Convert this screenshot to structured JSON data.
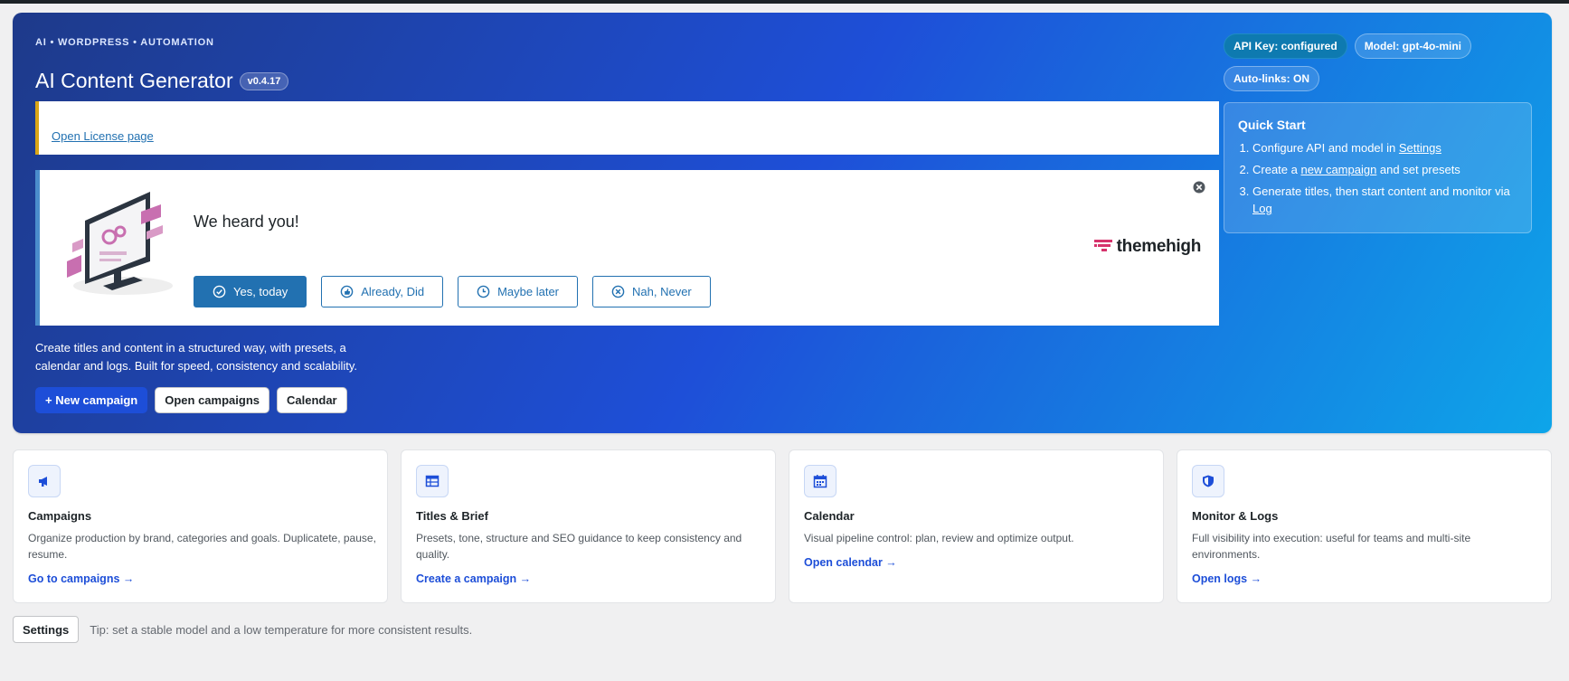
{
  "header": {
    "eyebrow": "AI • WORDPRESS • AUTOMATION",
    "title": "AI Content Generator",
    "version": "v0.4.17"
  },
  "license_notice": {
    "link_label": "Open License page"
  },
  "review_notice": {
    "title": "We heard you!",
    "brand": "themehigh",
    "brand_color": "#d6336c",
    "buttons": [
      {
        "label": "Yes, today",
        "icon": "check-circle-icon"
      },
      {
        "label": "Already, Did",
        "icon": "thumbs-up-icon"
      },
      {
        "label": "Maybe later",
        "icon": "clock-icon"
      },
      {
        "label": "Nah, Never",
        "icon": "x-circle-icon"
      }
    ]
  },
  "hero": {
    "description": "Create titles and content in a structured way, with presets, a calendar and logs. Built for speed, consistency and scalability.",
    "buttons": {
      "new_campaign": "+ New campaign",
      "open_campaigns": "Open campaigns",
      "calendar": "Calendar"
    }
  },
  "badges": {
    "api_key": "API Key: configured",
    "model": "Model: gpt-4o-mini",
    "auto_links": "Auto-links: ON"
  },
  "quick_start": {
    "title": "Quick Start",
    "step1_text": "Configure API and model in ",
    "step1_link": "Settings",
    "step2_pre": "Create a ",
    "step2_link": "new campaign",
    "step2_post": " and set presets",
    "step3_text": "Generate titles, then start content and monitor via ",
    "step3_link": "Log"
  },
  "cards": [
    {
      "title": "Campaigns",
      "description": "Organize production by brand, categories and goals. Duplicatete, pause, resume.",
      "link": "Go to campaigns →",
      "icon": "megaphone-icon"
    },
    {
      "title": "Titles & Brief",
      "description": "Presets, tone, structure and SEO guidance to keep consistency and quality.",
      "link": "Create a campaign →",
      "icon": "table-icon"
    },
    {
      "title": "Calendar",
      "description": "Visual pipeline control: plan, review and optimize output.",
      "link": "Open calendar →",
      "icon": "calendar-icon"
    },
    {
      "title": "Monitor & Logs",
      "description": "Full visibility into execution: useful for teams and multi-site environments.",
      "link": "Open logs →",
      "icon": "shield-icon"
    }
  ],
  "footer": {
    "settings_label": "Settings",
    "tip": "Tip: set a stable model and a low temperature for more consistent results."
  },
  "colors": {
    "accent": "#1d4ed8",
    "wp_blue": "#2271b1",
    "warning": "#dba617"
  }
}
